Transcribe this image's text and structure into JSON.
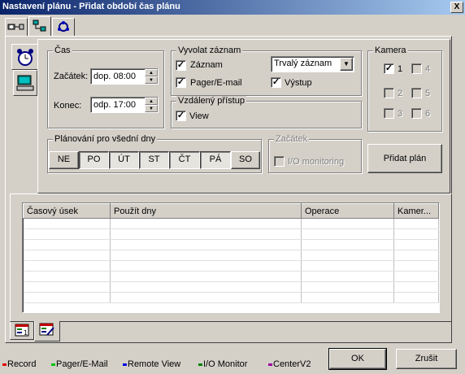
{
  "window": {
    "title": "Nastavení plánu - Přidat období čas plánu",
    "close_label": "X"
  },
  "top_tabs": [
    "camera-link-icon",
    "network-tree-icon",
    "network-sync-icon"
  ],
  "side_tabs": [
    "alarm-clock-icon",
    "desktop-computer-icon"
  ],
  "cas": {
    "legend": "Čas",
    "start_label": "Začátek:",
    "start_value": "dop. 08:00",
    "end_label": "Konec:",
    "end_value": "odp. 17:00"
  },
  "vyvolat": {
    "legend": "Vyvolat záznam",
    "record_label": "Záznam",
    "record_checked": true,
    "pager_label": "Pager/E-mail",
    "pager_checked": true,
    "record_type": "Trvalý záznam",
    "output_label": "Výstup",
    "output_checked": true
  },
  "remote": {
    "legend": "Vzdálený přístup",
    "view_label": "View",
    "view_checked": true
  },
  "kamera": {
    "legend": "Kamera",
    "cameras": [
      {
        "label": "1",
        "checked": true,
        "enabled": true
      },
      {
        "label": "4",
        "checked": false,
        "enabled": false
      },
      {
        "label": "2",
        "checked": false,
        "enabled": false
      },
      {
        "label": "5",
        "checked": false,
        "enabled": false
      },
      {
        "label": "3",
        "checked": false,
        "enabled": false
      },
      {
        "label": "6",
        "checked": false,
        "enabled": false
      }
    ]
  },
  "weekdays": {
    "legend": "Plánování pro všední dny",
    "days": [
      {
        "label": "NE",
        "pressed": false
      },
      {
        "label": "PO",
        "pressed": true
      },
      {
        "label": "ÚT",
        "pressed": true
      },
      {
        "label": "ST",
        "pressed": true
      },
      {
        "label": "ČT",
        "pressed": true
      },
      {
        "label": "PÁ",
        "pressed": true
      },
      {
        "label": "SO",
        "pressed": false
      }
    ]
  },
  "zacatek": {
    "legend": "Začátek",
    "io_label": "I/O monitoring",
    "io_checked": false
  },
  "add_plan_label": "Přidat plán",
  "table": {
    "columns": [
      "Časový úsek",
      "Použít dny",
      "Operace",
      "Kamer..."
    ],
    "rows": []
  },
  "bottom_tabs": [
    "calendar-list-icon",
    "calendar-edit-icon"
  ],
  "legend": [
    {
      "label": "Record",
      "color": "#e00000"
    },
    {
      "label": "Pager/E-Mail",
      "color": "#00c000"
    },
    {
      "label": "Remote View",
      "color": "#0000e0"
    },
    {
      "label": "I/O Monitor",
      "color": "#008000"
    },
    {
      "label": "CenterV2",
      "color": "#a000a0"
    }
  ],
  "ok_label": "OK",
  "cancel_label": "Zrušit"
}
